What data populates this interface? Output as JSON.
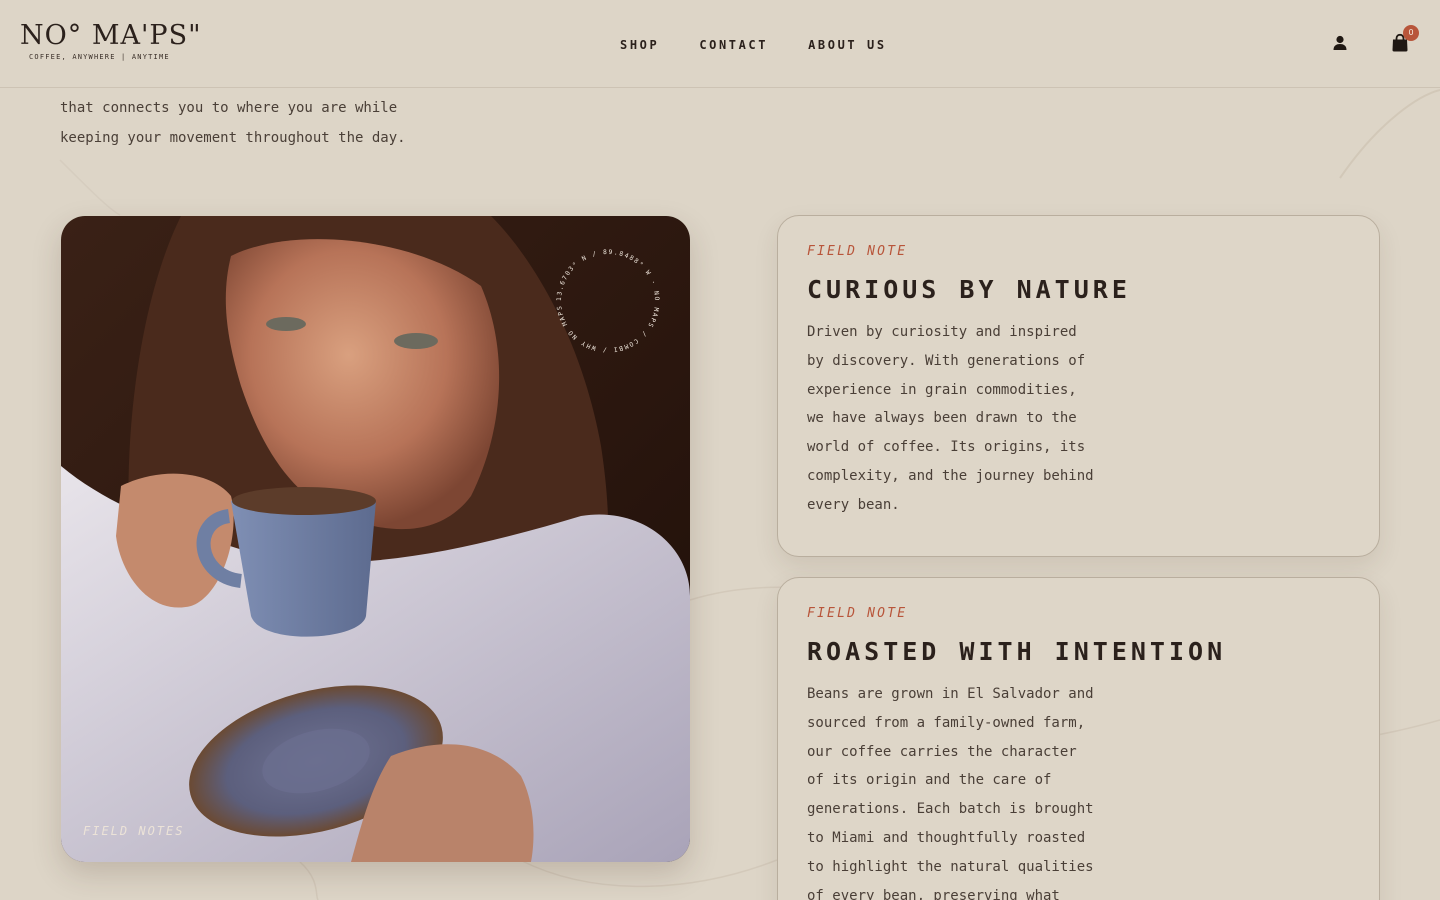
{
  "brand": {
    "name": "NO° MA'PS\"",
    "tagline": "COFFEE, ANYWHERE | ANYTIME"
  },
  "nav": {
    "items": [
      "SHOP",
      "CONTACT",
      "ABOUT US"
    ]
  },
  "header": {
    "account_icon": "user-icon",
    "cart_icon": "shopping-bag-icon",
    "cart_count": "0"
  },
  "intro": {
    "lines": [
      "that connects you to where you are while",
      "keeping your movement throughout the day."
    ]
  },
  "photo": {
    "caption": "FIELD NOTES",
    "stamp_text": "13.6703° N / 89.8488° W · NO MAPS / COMBI / WHY NO MAPS ·"
  },
  "cards": [
    {
      "kicker": "FIELD NOTE",
      "title": "CURIOUS BY NATURE",
      "lines": [
        "Driven by curiosity and inspired",
        "by discovery. With generations of",
        "experience in grain commodities,",
        "we have always been drawn to the",
        "world of coffee. Its origins, its",
        "complexity, and the journey behind",
        "every bean."
      ]
    },
    {
      "kicker": "FIELD NOTE",
      "title": "ROASTED WITH INTENTION",
      "lines": [
        "Beans are grown in El Salvador and",
        "sourced from a family-owned farm,",
        "our coffee carries the character",
        "of its origin and the care of",
        "generations. Each batch is brought",
        "to Miami and thoughtfully roasted",
        "to highlight the natural qualities",
        "of every bean, preserving what"
      ]
    }
  ],
  "colors": {
    "background": "#ddd5c7",
    "accent": "#b8553a",
    "text": "#2b211c"
  }
}
